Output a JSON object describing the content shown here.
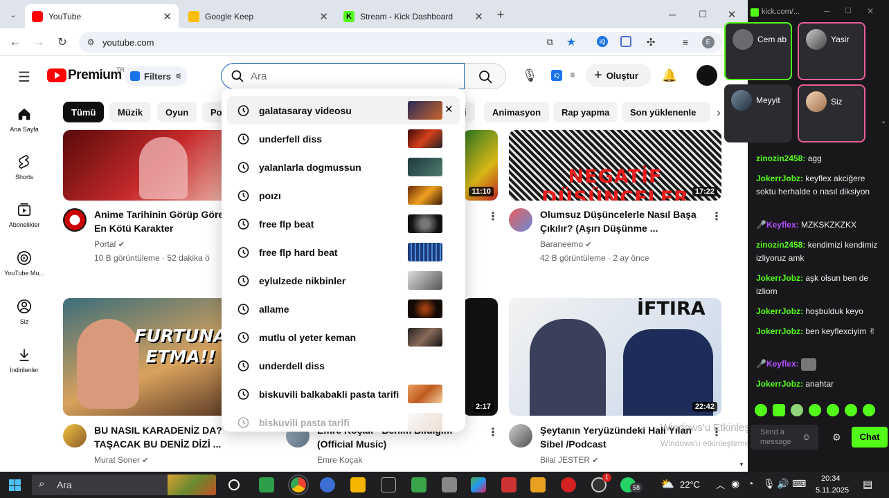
{
  "browser": {
    "tabs": [
      {
        "title": "YouTube",
        "color": "#ff0000"
      },
      {
        "title": "Google Keep",
        "color": "#fbbc04"
      },
      {
        "title": "Stream - Kick Dashboard",
        "color": "#53fc18"
      }
    ],
    "new_tab_icon": "plus-icon",
    "url": "youtube.com",
    "profile_initial": "E"
  },
  "youtube": {
    "logo_text": "Premium",
    "logo_sup": "TR",
    "filters_label": "Filters",
    "search_placeholder": "Ara",
    "create_label": "Oluştur",
    "chips": [
      "Tümü",
      "Müzik",
      "Oyun",
      "Po",
      "ri",
      "Animasyon",
      "Rap yapma",
      "Son yüklenenle"
    ],
    "guide": [
      {
        "label": "Ana Sayfa",
        "icon": "home-icon"
      },
      {
        "label": "Shorts",
        "icon": "shorts-icon"
      },
      {
        "label": "Abonelikler",
        "icon": "subscriptions-icon"
      },
      {
        "label": "YouTube Mu...",
        "icon": "youtube-music-icon"
      },
      {
        "label": "Siz",
        "icon": "you-icon"
      },
      {
        "label": "İndirilenler",
        "icon": "download-icon"
      }
    ],
    "videos": [
      {
        "title1": "Anime Tarihinin Görüp Göre",
        "title2": "En Kötü Karakter",
        "channel": "Portal",
        "stats": "10 B görüntüleme · 52 dakika ö"
      },
      {
        "title1": "Olumsuz Düşüncelerle Nasıl Başa",
        "title2": "Çıkılır? (Aşırı Düşünme ...",
        "channel": "Baraneemo",
        "stats": "42 B görüntüleme · 2 ay önce",
        "duration": "17:22",
        "thumb_text": "NEGATİF DÜŞÜNCELER"
      },
      {
        "duration": "11:10"
      },
      {
        "title1": "BU NASIL KARADENİZ DA?",
        "title2": "TAŞACAK BU DENİZ DİZİ ...",
        "channel": "Murat Soner",
        "thumb_text": "FURTUNA ETMA!!"
      },
      {
        "title1": "Emre Koçak - Benim Bildiğim",
        "title2": "(Official Music)",
        "channel": "Emre Koçak",
        "duration": "2:17"
      },
      {
        "title1": "Şeytanın Yeryüzündeki Hali Yılan",
        "title2": "Sibel /Podcast",
        "channel": "Bilal JESTER",
        "duration": "22:42",
        "thumb_text": "İFTIRA"
      }
    ],
    "suggestions": [
      "galatasaray videosu",
      "underfell diss",
      "yalanlarla dogmussun",
      "poızı",
      "free flp beat",
      "free flp hard beat",
      "eylulzede nikbinler",
      "allame",
      "mutlu ol yeter keman",
      "underdell diss",
      "biskuvili balkabakli pasta tarifi",
      "biskuvili pasta tarifi"
    ],
    "watermark1": "Windows'u Etkinleştir",
    "watermark2": "Windows'u etkinleştirmek için Ayarlar'a gidin"
  },
  "kick": {
    "url": "kick.com/...",
    "cams": [
      "Cem ab",
      "Yasir",
      "Meyyit",
      "Siz"
    ],
    "messages": [
      {
        "user": "zinozin2458",
        "text": "agg",
        "color": "#53fc18"
      },
      {
        "user": "JokerrJobz",
        "text": "keyflex akciğere soktu herhalde o nasıl diksiyon",
        "color": "#53fc18"
      },
      {
        "user": "Keyflex",
        "text": "MZKSKZKZKX",
        "color": "#b44dff"
      },
      {
        "user": "zinozin2458",
        "text": "kendimizi kendimiz izliyoruz amk",
        "color": "#53fc18"
      },
      {
        "user": "JokerrJobz",
        "text": "aşk olsun ben de izliom",
        "color": "#53fc18"
      },
      {
        "user": "JokerrJobz",
        "text": "hoşbulduk keyo",
        "color": "#53fc18"
      },
      {
        "user": "JokerrJobz",
        "text": "ben keyflexciyim ✌",
        "color": "#53fc18"
      },
      {
        "user": "Keyflex",
        "text": "",
        "color": "#b44dff"
      },
      {
        "user": "JokerrJobz",
        "text": "anahtar",
        "color": "#53fc18"
      }
    ],
    "send_placeholder": "Send a message",
    "chat_button": "Chat"
  },
  "taskbar": {
    "search_label": "Ara",
    "temperature": "22°C",
    "time": "20:34",
    "date": "5.11.2025",
    "whatsapp_badge": "58",
    "red_badge": "1"
  }
}
